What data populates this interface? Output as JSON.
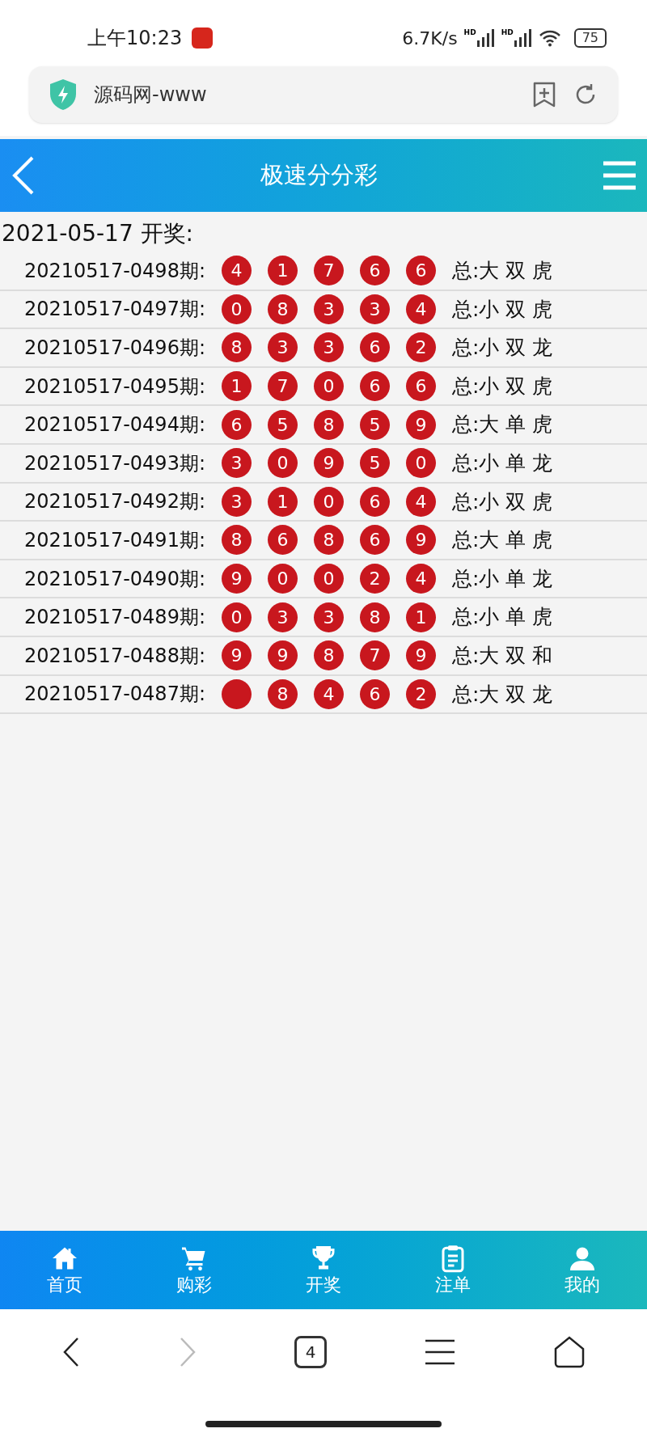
{
  "status_bar": {
    "time": "上午10:23",
    "speed": "6.7K/s",
    "signal_label_1": "HD",
    "signal_label_2": "HD",
    "battery": "75"
  },
  "address_bar": {
    "url": "源码网-www"
  },
  "header": {
    "title": "极速分分彩"
  },
  "draw_date": "2021-05-17 开奖:",
  "results": [
    {
      "issue": "20210517-0498期:",
      "balls": [
        "4",
        "1",
        "7",
        "6",
        "6"
      ],
      "summary": "总:大 双 虎"
    },
    {
      "issue": "20210517-0497期:",
      "balls": [
        "0",
        "8",
        "3",
        "3",
        "4"
      ],
      "summary": "总:小 双 虎"
    },
    {
      "issue": "20210517-0496期:",
      "balls": [
        "8",
        "3",
        "3",
        "6",
        "2"
      ],
      "summary": "总:小 双 龙"
    },
    {
      "issue": "20210517-0495期:",
      "balls": [
        "1",
        "7",
        "0",
        "6",
        "6"
      ],
      "summary": "总:小 双 虎"
    },
    {
      "issue": "20210517-0494期:",
      "balls": [
        "6",
        "5",
        "8",
        "5",
        "9"
      ],
      "summary": "总:大 单 虎"
    },
    {
      "issue": "20210517-0493期:",
      "balls": [
        "3",
        "0",
        "9",
        "5",
        "0"
      ],
      "summary": "总:小 单 龙"
    },
    {
      "issue": "20210517-0492期:",
      "balls": [
        "3",
        "1",
        "0",
        "6",
        "4"
      ],
      "summary": "总:小 双 虎"
    },
    {
      "issue": "20210517-0491期:",
      "balls": [
        "8",
        "6",
        "8",
        "6",
        "9"
      ],
      "summary": "总:大 单 虎"
    },
    {
      "issue": "20210517-0490期:",
      "balls": [
        "9",
        "0",
        "0",
        "2",
        "4"
      ],
      "summary": "总:小 单 龙"
    },
    {
      "issue": "20210517-0489期:",
      "balls": [
        "0",
        "3",
        "3",
        "8",
        "1"
      ],
      "summary": "总:小 单 虎"
    },
    {
      "issue": "20210517-0488期:",
      "balls": [
        "9",
        "9",
        "8",
        "7",
        "9"
      ],
      "summary": "总:大 双 和"
    },
    {
      "issue": "20210517-0487期:",
      "balls": [
        "8",
        "4",
        "6",
        "2"
      ],
      "summary": "总:大 双 龙"
    }
  ],
  "bottom_nav": [
    {
      "label": "首页",
      "kind": "home"
    },
    {
      "label": "购彩",
      "kind": "cart"
    },
    {
      "label": "开奖",
      "kind": "trophy"
    },
    {
      "label": "注单",
      "kind": "clipboard"
    },
    {
      "label": "我的",
      "kind": "user"
    }
  ],
  "browser_bar": {
    "tab_count": "4"
  }
}
